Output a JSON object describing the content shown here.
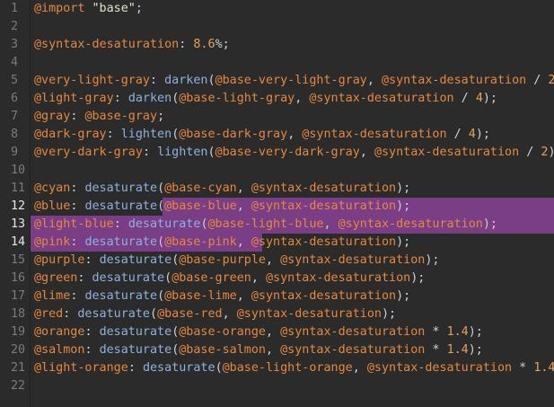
{
  "editor": {
    "colors": {
      "background": "#2b2b2b",
      "gutter_text": "#7b7b7b",
      "gutter_text_active": "#e6e6e6",
      "selection": "#7a3e86",
      "variable": "#e8873d",
      "function": "#8fb1e0",
      "string": "#e3e3c6",
      "number": "#e8a15a",
      "text": "#cfcfcf"
    },
    "active_lines": [
      12,
      13,
      14
    ],
    "lines": [
      {
        "n": "1",
        "tokens": [
          [
            "at",
            "@import"
          ],
          [
            "punc",
            " "
          ],
          [
            "str",
            "\"base\""
          ],
          [
            "punc",
            ";"
          ]
        ]
      },
      {
        "n": "2",
        "tokens": []
      },
      {
        "n": "3",
        "tokens": [
          [
            "at",
            "@syntax-desaturation"
          ],
          [
            "punc",
            ": "
          ],
          [
            "num",
            "8.6"
          ],
          [
            "punc",
            "%;"
          ]
        ]
      },
      {
        "n": "4",
        "tokens": []
      },
      {
        "n": "5",
        "tokens": [
          [
            "at",
            "@very-light-gray"
          ],
          [
            "punc",
            ": "
          ],
          [
            "fn",
            "darken"
          ],
          [
            "punc",
            "("
          ],
          [
            "at",
            "@base-very-light-gray"
          ],
          [
            "punc",
            ", "
          ],
          [
            "at",
            "@syntax-desaturation"
          ],
          [
            "op",
            " / "
          ],
          [
            "num",
            "2"
          ],
          [
            "punc",
            ");"
          ]
        ]
      },
      {
        "n": "6",
        "tokens": [
          [
            "at",
            "@light-gray"
          ],
          [
            "punc",
            ": "
          ],
          [
            "fn",
            "darken"
          ],
          [
            "punc",
            "("
          ],
          [
            "at",
            "@base-light-gray"
          ],
          [
            "punc",
            ", "
          ],
          [
            "at",
            "@syntax-desaturation"
          ],
          [
            "op",
            " / "
          ],
          [
            "num",
            "4"
          ],
          [
            "punc",
            ");"
          ]
        ]
      },
      {
        "n": "7",
        "tokens": [
          [
            "at",
            "@gray"
          ],
          [
            "punc",
            ": "
          ],
          [
            "at",
            "@base-gray"
          ],
          [
            "punc",
            ";"
          ]
        ]
      },
      {
        "n": "8",
        "tokens": [
          [
            "at",
            "@dark-gray"
          ],
          [
            "punc",
            ": "
          ],
          [
            "fn",
            "lighten"
          ],
          [
            "punc",
            "("
          ],
          [
            "at",
            "@base-dark-gray"
          ],
          [
            "punc",
            ", "
          ],
          [
            "at",
            "@syntax-desaturation"
          ],
          [
            "op",
            " / "
          ],
          [
            "num",
            "4"
          ],
          [
            "punc",
            ");"
          ]
        ]
      },
      {
        "n": "9",
        "tokens": [
          [
            "at",
            "@very-dark-gray"
          ],
          [
            "punc",
            ": "
          ],
          [
            "fn",
            "lighten"
          ],
          [
            "punc",
            "("
          ],
          [
            "at",
            "@base-very-dark-gray"
          ],
          [
            "punc",
            ", "
          ],
          [
            "at",
            "@syntax-desaturation"
          ],
          [
            "op",
            " / "
          ],
          [
            "num",
            "2"
          ],
          [
            "punc",
            ");"
          ]
        ]
      },
      {
        "n": "10",
        "tokens": []
      },
      {
        "n": "11",
        "tokens": [
          [
            "at",
            "@cyan"
          ],
          [
            "punc",
            ": "
          ],
          [
            "fn",
            "desaturate"
          ],
          [
            "punc",
            "("
          ],
          [
            "at",
            "@base-cyan"
          ],
          [
            "punc",
            ", "
          ],
          [
            "at",
            "@syntax-desaturation"
          ],
          [
            "punc",
            ");"
          ]
        ]
      },
      {
        "n": "12",
        "tokens": [
          [
            "at",
            "@blue"
          ],
          [
            "punc",
            ": "
          ],
          [
            "fn",
            "desaturate"
          ],
          [
            "punc",
            "("
          ],
          [
            "at",
            "@base-blue"
          ],
          [
            "punc",
            ", "
          ],
          [
            "at",
            "@syntax-desaturation"
          ],
          [
            "punc",
            ");"
          ]
        ]
      },
      {
        "n": "13",
        "tokens": [
          [
            "at",
            "@light-blue"
          ],
          [
            "punc",
            ": "
          ],
          [
            "fn",
            "desaturate"
          ],
          [
            "punc",
            "("
          ],
          [
            "at",
            "@base-light-blue"
          ],
          [
            "punc",
            ", "
          ],
          [
            "at",
            "@syntax-desaturation"
          ],
          [
            "punc",
            ");"
          ]
        ]
      },
      {
        "n": "14",
        "tokens": [
          [
            "at",
            "@pink"
          ],
          [
            "punc",
            ": "
          ],
          [
            "fn",
            "desaturate"
          ],
          [
            "punc",
            "("
          ],
          [
            "at",
            "@base-pink"
          ],
          [
            "punc",
            ", "
          ],
          [
            "at",
            "@syntax-desaturation"
          ],
          [
            "punc",
            ");"
          ]
        ]
      },
      {
        "n": "15",
        "tokens": [
          [
            "at",
            "@purple"
          ],
          [
            "punc",
            ": "
          ],
          [
            "fn",
            "desaturate"
          ],
          [
            "punc",
            "("
          ],
          [
            "at",
            "@base-purple"
          ],
          [
            "punc",
            ", "
          ],
          [
            "at",
            "@syntax-desaturation"
          ],
          [
            "punc",
            ");"
          ]
        ]
      },
      {
        "n": "16",
        "tokens": [
          [
            "at",
            "@green"
          ],
          [
            "punc",
            ": "
          ],
          [
            "fn",
            "desaturate"
          ],
          [
            "punc",
            "("
          ],
          [
            "at",
            "@base-green"
          ],
          [
            "punc",
            ", "
          ],
          [
            "at",
            "@syntax-desaturation"
          ],
          [
            "punc",
            ");"
          ]
        ]
      },
      {
        "n": "17",
        "tokens": [
          [
            "at",
            "@lime"
          ],
          [
            "punc",
            ": "
          ],
          [
            "fn",
            "desaturate"
          ],
          [
            "punc",
            "("
          ],
          [
            "at",
            "@base-lime"
          ],
          [
            "punc",
            ", "
          ],
          [
            "at",
            "@syntax-desaturation"
          ],
          [
            "punc",
            ");"
          ]
        ]
      },
      {
        "n": "18",
        "tokens": [
          [
            "at",
            "@red"
          ],
          [
            "punc",
            ": "
          ],
          [
            "fn",
            "desaturate"
          ],
          [
            "punc",
            "("
          ],
          [
            "at",
            "@base-red"
          ],
          [
            "punc",
            ", "
          ],
          [
            "at",
            "@syntax-desaturation"
          ],
          [
            "punc",
            ");"
          ]
        ]
      },
      {
        "n": "19",
        "tokens": [
          [
            "at",
            "@orange"
          ],
          [
            "punc",
            ": "
          ],
          [
            "fn",
            "desaturate"
          ],
          [
            "punc",
            "("
          ],
          [
            "at",
            "@base-orange"
          ],
          [
            "punc",
            ", "
          ],
          [
            "at",
            "@syntax-desaturation"
          ],
          [
            "op",
            " * "
          ],
          [
            "num",
            "1.4"
          ],
          [
            "punc",
            ");"
          ]
        ]
      },
      {
        "n": "20",
        "tokens": [
          [
            "at",
            "@salmon"
          ],
          [
            "punc",
            ": "
          ],
          [
            "fn",
            "desaturate"
          ],
          [
            "punc",
            "("
          ],
          [
            "at",
            "@base-salmon"
          ],
          [
            "punc",
            ", "
          ],
          [
            "at",
            "@syntax-desaturation"
          ],
          [
            "op",
            " * "
          ],
          [
            "num",
            "1.4"
          ],
          [
            "punc",
            ");"
          ]
        ]
      },
      {
        "n": "21",
        "tokens": [
          [
            "at",
            "@light-orange"
          ],
          [
            "punc",
            ": "
          ],
          [
            "fn",
            "desaturate"
          ],
          [
            "punc",
            "("
          ],
          [
            "at",
            "@base-light-orange"
          ],
          [
            "punc",
            ", "
          ],
          [
            "at",
            "@syntax-desaturation"
          ],
          [
            "op",
            " * "
          ],
          [
            "num",
            "1.4"
          ],
          [
            "punc",
            ");"
          ]
        ]
      },
      {
        "n": "22",
        "tokens": []
      }
    ]
  }
}
